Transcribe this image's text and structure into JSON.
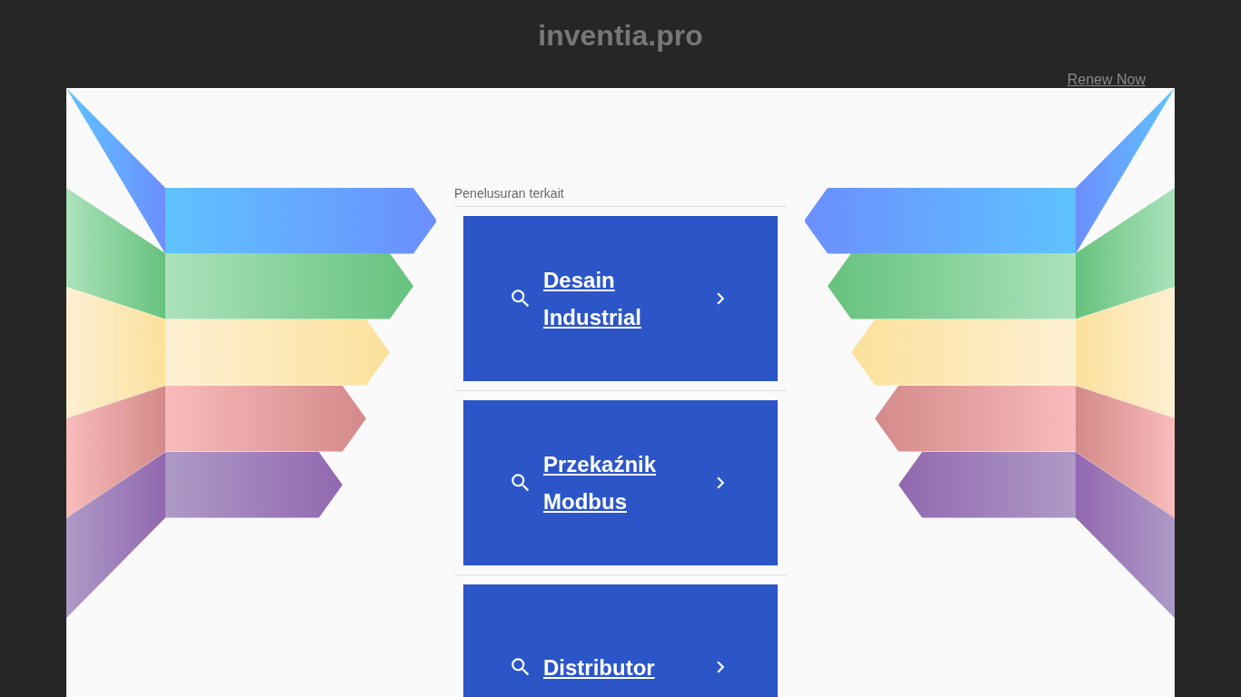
{
  "header": {
    "title": "inventia.pro",
    "renew_link": "Renew Now"
  },
  "related": {
    "heading": "Penelusuran terkait",
    "items": [
      {
        "label": "Desain Industrial"
      },
      {
        "label": "Przekaźnik Modbus"
      },
      {
        "label": "Distributor"
      }
    ]
  }
}
